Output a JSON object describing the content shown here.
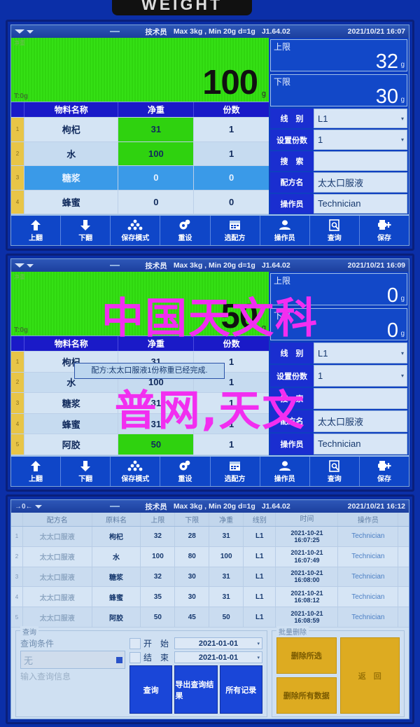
{
  "device": {
    "brand_plaque": "WEIGHT",
    "status": {
      "operator_role": "技术员",
      "capacity": "Max 3kg , Min 20g  d=1g",
      "firmware": "J1.64.02",
      "zero_icon": "zero-indicator-icon",
      "stability_icon": "stability-icon"
    }
  },
  "panels": [
    {
      "id": "panel-weigh-1",
      "datetime": "2021/10/21  16:07",
      "display": {
        "tare_label": "T:0g",
        "corner_label": "净重",
        "value": "100",
        "unit": "g"
      },
      "limits": {
        "upper_label": "上限",
        "upper_value": "32",
        "upper_unit": "g",
        "lower_label": "下限",
        "lower_value": "30",
        "lower_unit": "g"
      },
      "table": {
        "columns": [
          "物料名称",
          "净重",
          "份数"
        ],
        "rows": [
          {
            "index": "1",
            "name": "枸杞",
            "net": "31",
            "portions": "1",
            "state": "active"
          },
          {
            "index": "2",
            "name": "水",
            "net": "100",
            "portions": "1",
            "state": "active"
          },
          {
            "index": "3",
            "name": "糖浆",
            "net": "0",
            "portions": "0",
            "state": "selected"
          },
          {
            "index": "4",
            "name": "蜂蜜",
            "net": "0",
            "portions": "0",
            "state": "normal"
          }
        ]
      },
      "fields": [
        {
          "label": "线　别",
          "value": "L1",
          "type": "dropdown"
        },
        {
          "label": "设置份数",
          "value": "1",
          "type": "dropdown"
        },
        {
          "label": "搜　索",
          "value": "",
          "type": "text"
        },
        {
          "label": "配方名",
          "value": "太太口服液",
          "type": "text"
        },
        {
          "label": "操作员",
          "value": "Technician",
          "type": "text"
        }
      ]
    },
    {
      "id": "panel-weigh-2",
      "datetime": "2021/10/21  16:09",
      "display": {
        "tare_label": "T:0g",
        "corner_label": "净重",
        "value": "50",
        "unit": "g"
      },
      "limits": {
        "upper_label": "上限",
        "upper_value": "0",
        "upper_unit": "g",
        "lower_label": "下限",
        "lower_value": "0",
        "lower_unit": "g"
      },
      "table": {
        "columns": [
          "物料名称",
          "净重",
          "份数"
        ],
        "rows": [
          {
            "index": "1",
            "name": "枸杞",
            "net": "31",
            "portions": "1",
            "state": "normal"
          },
          {
            "index": "2",
            "name": "水",
            "net": "100",
            "portions": "1",
            "state": "normal"
          },
          {
            "index": "3",
            "name": "糖浆",
            "net": "31",
            "portions": "1",
            "state": "normal"
          },
          {
            "index": "4",
            "name": "蜂蜜",
            "net": "31",
            "portions": "1",
            "state": "normal"
          },
          {
            "index": "5",
            "name": "阿胶",
            "net": "50",
            "portions": "1",
            "state": "active"
          }
        ]
      },
      "fields": [
        {
          "label": "线　别",
          "value": "L1",
          "type": "dropdown"
        },
        {
          "label": "设置份数",
          "value": "1",
          "type": "dropdown"
        },
        {
          "label": "搜　索",
          "value": "",
          "type": "text"
        },
        {
          "label": "配方名",
          "value": "太太口服液",
          "type": "text"
        },
        {
          "label": "操作员",
          "value": "Technician",
          "type": "text"
        }
      ],
      "dialog": {
        "message": "配方:太太口服液1份称重已经完成."
      }
    }
  ],
  "toolbar": {
    "buttons": [
      {
        "label": "上翻",
        "icon": "arrow-up-icon"
      },
      {
        "label": "下翻",
        "icon": "arrow-down-icon"
      },
      {
        "label": "保存模式",
        "icon": "stack-icon"
      },
      {
        "label": "重设",
        "icon": "gear-icon"
      },
      {
        "label": "选配方",
        "icon": "calendar-icon"
      },
      {
        "label": "操作员",
        "icon": "user-icon"
      },
      {
        "label": "查询",
        "icon": "document-search-icon"
      },
      {
        "label": "保存",
        "icon": "save-plus-icon"
      }
    ]
  },
  "log_panel": {
    "id": "panel-records",
    "datetime": "2021/10/21  16:12",
    "columns": [
      "配方名",
      "原料名",
      "上限",
      "下限",
      "净重",
      "线别",
      "时间",
      "操作员"
    ],
    "rows": [
      {
        "index": "1",
        "recipe": "太太口服液",
        "material": "枸杞",
        "upper": "32",
        "lower": "28",
        "net": "31",
        "line": "L1",
        "date": "2021-10-21",
        "time": "16:07:25",
        "operator": "Technician"
      },
      {
        "index": "2",
        "recipe": "太太口服液",
        "material": "水",
        "upper": "100",
        "lower": "80",
        "net": "100",
        "line": "L1",
        "date": "2021-10-21",
        "time": "16:07:49",
        "operator": "Technician"
      },
      {
        "index": "3",
        "recipe": "太太口服液",
        "material": "糖浆",
        "upper": "32",
        "lower": "30",
        "net": "31",
        "line": "L1",
        "date": "2021-10-21",
        "time": "16:08:00",
        "operator": "Technician"
      },
      {
        "index": "4",
        "recipe": "太太口服液",
        "material": "蜂蜜",
        "upper": "35",
        "lower": "30",
        "net": "31",
        "line": "L1",
        "date": "2021-10-21",
        "time": "16:08:12",
        "operator": "Technician"
      },
      {
        "index": "5",
        "recipe": "太太口服液",
        "material": "阿胶",
        "upper": "50",
        "lower": "45",
        "net": "50",
        "line": "L1",
        "date": "2021-10-21",
        "time": "16:08:59",
        "operator": "Technician"
      }
    ],
    "query": {
      "group_title": "查询",
      "condition_label": "查询条件",
      "condition_value": "无",
      "input_placeholder": "输入查询信息",
      "start_label": "开　始",
      "start_value": "2021-01-01",
      "end_label": "结　束",
      "end_value": "2021-01-01",
      "buttons": [
        "查询",
        "导出查询结果",
        "所有记录"
      ]
    },
    "delete": {
      "group_title": "批量删除",
      "buttons": [
        "删除所选",
        "删除所有数据"
      ],
      "back_label": "返　回"
    }
  },
  "watermark": {
    "line1": "中国天文科",
    "line2": "普网,天文",
    "color": "#f22ef0"
  }
}
